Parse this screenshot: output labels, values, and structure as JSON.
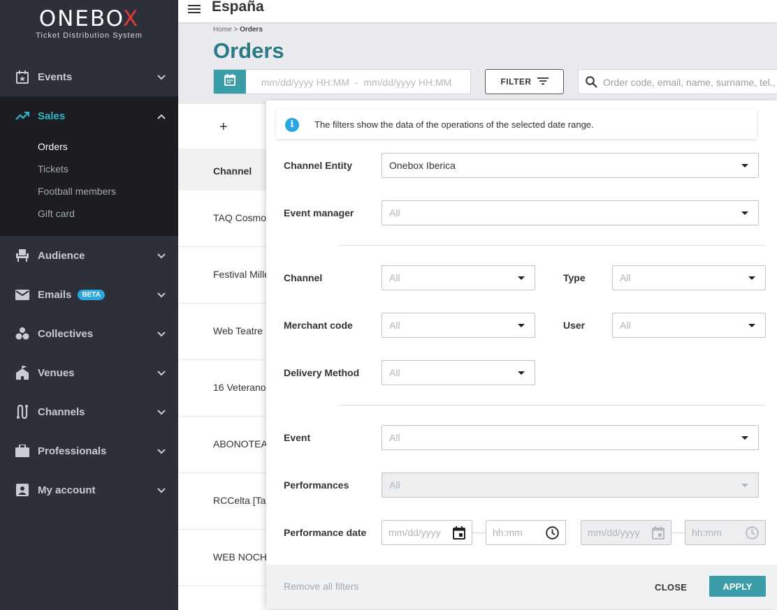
{
  "brand": {
    "name_prefix": "ONEBO",
    "name_suffix": "X",
    "tagline": "Ticket Distribution System"
  },
  "sidebar": {
    "items": [
      {
        "label": "Events",
        "icon": "calendar-star-icon"
      },
      {
        "label": "Sales",
        "icon": "trending-up-icon",
        "active": true
      },
      {
        "label": "Audience",
        "icon": "theater-seat-icon"
      },
      {
        "label": "Emails",
        "icon": "envelope-icon",
        "badge": "BETA"
      },
      {
        "label": "Collectives",
        "icon": "group-icon"
      },
      {
        "label": "Venues",
        "icon": "building-icon"
      },
      {
        "label": "Channels",
        "icon": "route-icon"
      },
      {
        "label": "Professionals",
        "icon": "briefcase-icon"
      },
      {
        "label": "My account",
        "icon": "account-box-icon"
      }
    ],
    "sales_subitems": [
      "Orders",
      "Tickets",
      "Football members",
      "Gift card"
    ]
  },
  "topbar": {
    "title": "España"
  },
  "breadcrumb": {
    "home": "Home",
    "separator": ">",
    "current": "Orders"
  },
  "page": {
    "title": "Orders"
  },
  "toolbar": {
    "date_range_placeholder": "mm/dd/yyyy HH:MM  -  mm/dd/yyyy HH:MM",
    "filter_label": "FILTER",
    "search_placeholder": "Order code, email, name, surname, tel., b"
  },
  "table": {
    "add_symbol": "+",
    "column_channel": "Channel",
    "rows": [
      "TAQ Cosmo",
      "Festival Mille",
      "Web Teatre",
      "16 Veterano",
      "ABONOTEA",
      "RCCelta [Tac",
      "WEB NOCH"
    ]
  },
  "filter_panel": {
    "info_text": "The filters show the data of the operations of the selected date range.",
    "fields": {
      "channel_entity": {
        "label": "Channel Entity",
        "value": "Onebox Iberica"
      },
      "event_manager": {
        "label": "Event manager",
        "value": "All"
      },
      "channel": {
        "label": "Channel",
        "value": "All"
      },
      "type": {
        "label": "Type",
        "value": "All"
      },
      "merchant_code": {
        "label": "Merchant code",
        "value": "All"
      },
      "user": {
        "label": "User",
        "value": "All"
      },
      "delivery_method": {
        "label": "Delivery Method",
        "value": "All"
      },
      "event": {
        "label": "Event",
        "value": "All"
      },
      "performances": {
        "label": "Performances",
        "value": "All"
      },
      "performance_date": {
        "label": "Performance date",
        "date_placeholder": "mm/dd/yyyy",
        "time_placeholder": "hh:mm"
      }
    },
    "remove_all": "Remove all filters",
    "close": "CLOSE",
    "apply": "APPLY"
  },
  "colors": {
    "accent": "#3a9da8",
    "title": "#287a84",
    "sidebar_bg": "#2d3038",
    "active_nav": "#2fb7c4",
    "beta": "#29a8e0"
  }
}
